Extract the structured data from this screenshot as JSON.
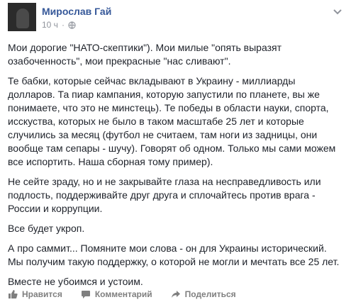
{
  "post": {
    "author": "Мирослав Гай",
    "time": "10 ч",
    "dot": "·",
    "paragraphs": [
      "Мои дорогие \"НАТО-скептики\"). Мои милые \"опять выразят озабоченность\", мои прекрасные \"нас сливают\".",
      "Те бабки, которые сейчас вкладывают в Украину - миллиарды долларов. Та пиар кампания, которую запустили по планете, вы же понимаете, что это не минстець). Те победы в области науки, спорта, исскуства, которых не было в таком масштабе 25 лет и которые случились за месяц (футбол не считаем, там ноги из задницы, они вообще там сепары - шучу). Говорят об одном. Только мы сами можем все испортить. Наша сборная тому пример).",
      "Не сейте зраду, но и не закрывайте глаза на несправедливость или подлость, поддерживайте друг друга и сплочайтесь против врага - России и коррупции.",
      "Все будет укроп.",
      "А про саммит... Помяните мои слова - он для Украины исторический. Мы получим такую поддержку, о которой не могли и мечтать все 25 лет.",
      "Вместе не убоимся и устоим."
    ]
  },
  "actions": {
    "like": "Нравится",
    "comment": "Комментарий",
    "share": "Поделиться"
  },
  "icons": {
    "privacy": "globe-icon",
    "menu": "chevron-down-icon",
    "like": "thumbs-up-icon",
    "comment": "comment-icon",
    "share": "share-icon"
  }
}
